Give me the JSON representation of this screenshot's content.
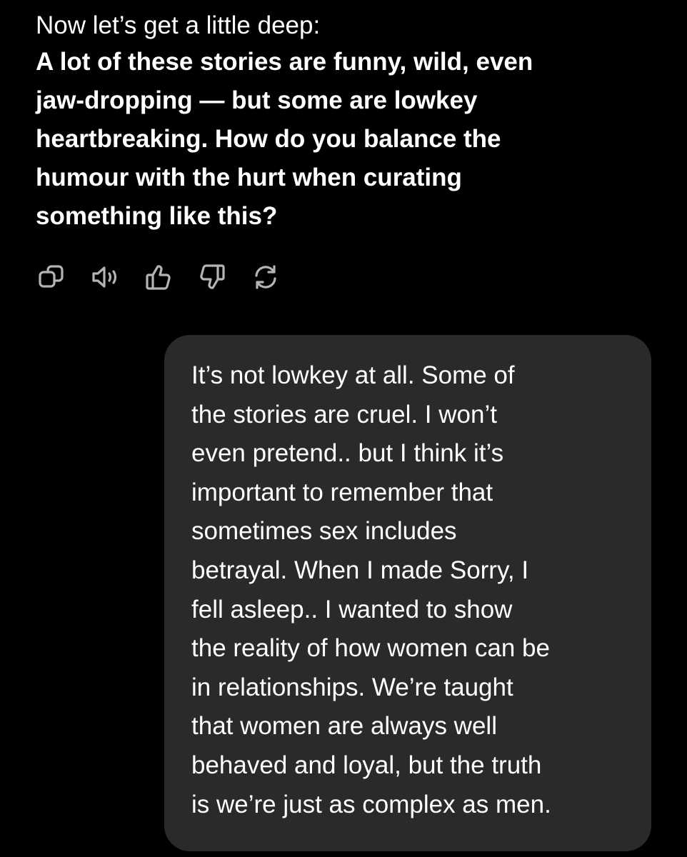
{
  "assistant": {
    "intro": "Now let’s get a little deep:",
    "question": "A lot of these stories are funny, wild, even\njaw-dropping — but some are lowkey\nheartbreaking. How do you balance the\nhumour with the hurt when curating\nsomething like this?"
  },
  "actions": [
    {
      "icon": "copy-icon"
    },
    {
      "icon": "speaker-icon"
    },
    {
      "icon": "thumbs-up-icon"
    },
    {
      "icon": "thumbs-down-icon"
    },
    {
      "icon": "regenerate-icon"
    }
  ],
  "user": {
    "message": "It’s not lowkey at all. Some of\nthe stories are cruel. I won’t\neven pretend.. but I think it’s\nimportant to remember that\nsometimes sex includes\nbetrayal. When I made Sorry, I\nfell asleep.. I wanted to show\nthe reality of how women can be\nin relationships. We’re taught\nthat women are always well\nbehaved and loyal, but the truth\nis we’re just as complex as men."
  },
  "colors": {
    "background": "#000000",
    "bubble": "#2a2a2a",
    "text": "#ffffff",
    "icon": "#b4b4b4"
  }
}
